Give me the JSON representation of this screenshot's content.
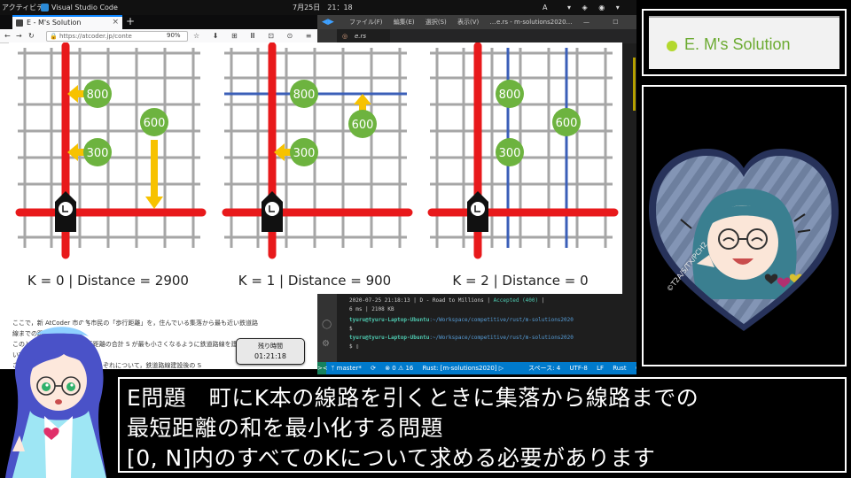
{
  "os_bar": {
    "activities": "アクティビティ",
    "app_name": "Visual Studio Code",
    "clock": "7月25日　21：18",
    "ime": "A",
    "tray": "▾ ◈ ◉ ▾"
  },
  "browser": {
    "tab_title": "E - M's Solution",
    "tab_close": "×",
    "new_tab": "+",
    "url": "https://atcoder.jp/conte",
    "zoom": "90%",
    "toolbar_icons": "☆ ⬇ ⊞ Ⅲ ⊡ ⊙ ≡",
    "paragraph1": "ここで，新 AtCoder 市の各市民の「歩行距離」を，住んでいる集落から最も近い鉄道路",
    "paragraph2": "線までの距離とします。",
    "paragraph3": "このとき，全ての市民の歩行距離の合計 S が最も小さくなるように鉄道路線を建設した",
    "paragraph4": "いです。",
    "paragraph5": "さて，K = 0, 1, 2, …, N のそれぞれについて，鉄道路線建設後の S"
  },
  "diagram": {
    "panels": [
      {
        "k_label": "K = 0  |  Distance = 2900",
        "nodes": [
          "800",
          "300",
          "600"
        ]
      },
      {
        "k_label": "K = 1  |  Distance = 900",
        "nodes": [
          "800",
          "600",
          "300"
        ]
      },
      {
        "k_label": "K = 2  |  Distance = 0",
        "nodes": [
          "800",
          "300",
          "600"
        ]
      }
    ],
    "colors": {
      "main_road": "#e8191b",
      "new_rail": "#3b5fb8",
      "arrow": "#f7c200",
      "node": "#6db33f",
      "grid": "#a6a6a6"
    }
  },
  "vscode": {
    "logo": "◀▶",
    "menus": [
      "ファイル(F)",
      "編集(E)",
      "選択(S)",
      "表示(V)",
      "…"
    ],
    "window_title": "e.rs - m-solutions2020…",
    "window_controls": "— ☐ ✕",
    "tab_icon": "◎",
    "tab_name": "e.rs",
    "terminal": {
      "line1_date": "2020-07-25 21:18:13 | D - Road to Millions | ",
      "line1_status": "Accepted (400)",
      "line1_tail": " |",
      "line2": "6 ms | 2108 KB",
      "prompt_user": "tyuru@tyuru-Laptop-Ubuntu",
      "prompt_path": ":~/Workspace/competitive/rust/m-solutions2020",
      "dollar": "$",
      "dollar_cursor": "$ ▯"
    },
    "status": {
      "remote": "><",
      "branch": "ᛘ master*",
      "sync": "⟳",
      "problems": "⊗ 0  ⚠ 16",
      "rust": "Rust: [m-solutions2020] ▷",
      "spaces": "スペース: 4",
      "encoding": "UTF-8",
      "eol": "LF",
      "language": "Rust",
      "feedback": "☺ 🔔"
    }
  },
  "timer": {
    "label": "残り時間",
    "value": "01:21:18"
  },
  "title_panel": {
    "text": "E. M's Solution"
  },
  "avatar": {
    "watermark": "©T2A/S/TX/PCH2"
  },
  "subtitle": {
    "line1": "E問題　町にK本の線路を引くときに集落から線路までの",
    "line2": "最短距離の和を最小化する問題",
    "line3": "[0, N]内のすべてのKについて求める必要があります"
  }
}
